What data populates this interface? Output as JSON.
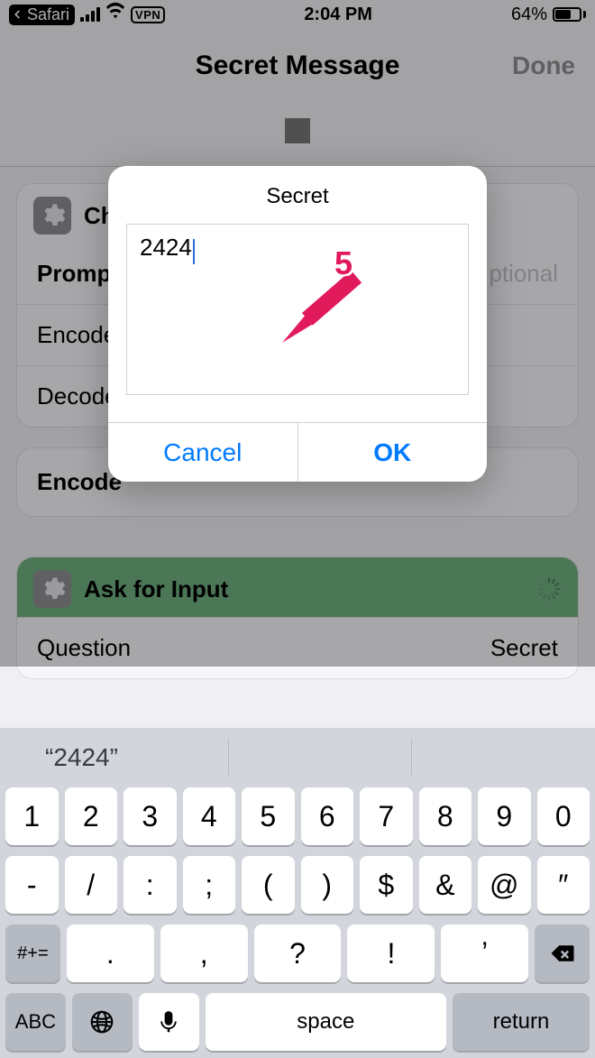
{
  "status": {
    "back_app": "Safari",
    "vpn": "VPN",
    "clock": "2:04 PM",
    "battery_pct": "64%"
  },
  "nav": {
    "title": "Secret Message",
    "done": "Done"
  },
  "card1": {
    "title_partial": "Ch",
    "rows": {
      "r0": {
        "label": "Promp",
        "trail": "ptional"
      },
      "r1": {
        "label": "Encode"
      },
      "r2": {
        "label": "Decode"
      }
    }
  },
  "encode_row": {
    "label": "Encode"
  },
  "card2": {
    "title": "Ask for Input",
    "row0": {
      "label": "Question",
      "value": "Secret"
    }
  },
  "alert": {
    "title": "Secret",
    "input_value": "2424",
    "cancel": "Cancel",
    "ok": "OK"
  },
  "annotation": {
    "number": "5"
  },
  "kb": {
    "suggestion": "“2424”",
    "row1": [
      "1",
      "2",
      "3",
      "4",
      "5",
      "6",
      "7",
      "8",
      "9",
      "0"
    ],
    "row2": [
      "-",
      "/",
      ":",
      ";",
      "(",
      ")",
      "$",
      "&",
      "@",
      "″"
    ],
    "row3_shift": "#+=",
    "row3": [
      ".",
      ",",
      "?",
      "!",
      "ʼ"
    ],
    "abc": "ABC",
    "space": "space",
    "return": "return"
  }
}
